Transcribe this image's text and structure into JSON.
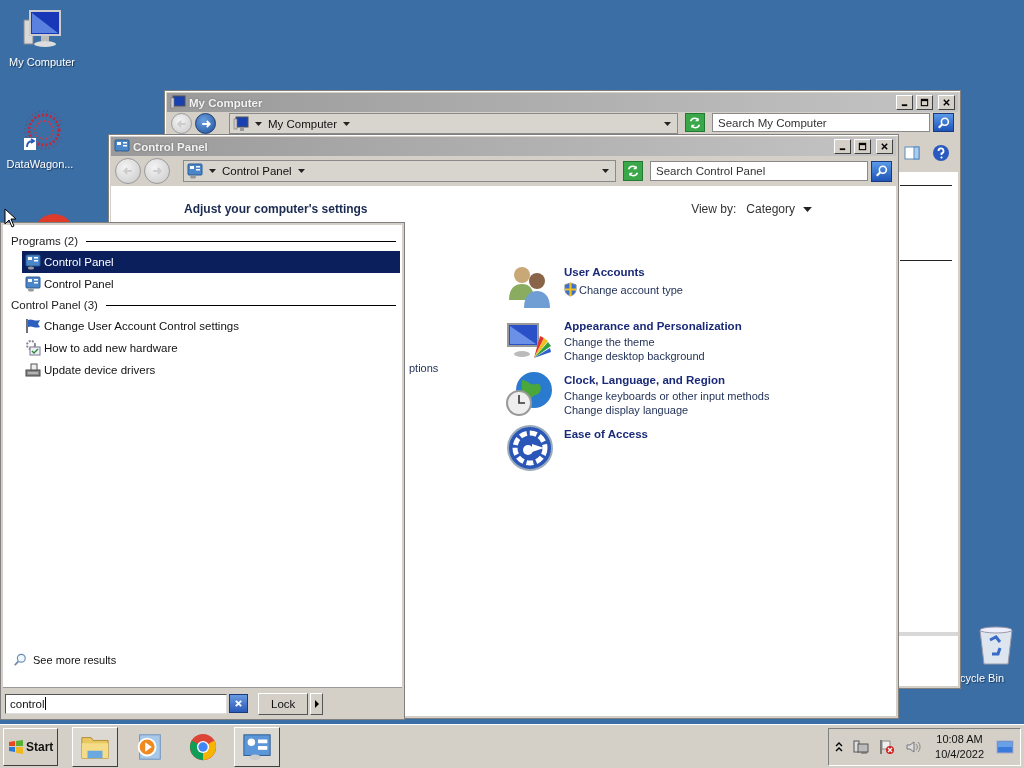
{
  "desktop_icons": [
    {
      "kind": "computer",
      "label": "My Computer"
    },
    {
      "kind": "datawagon",
      "label": "DataWagon..."
    },
    {
      "kind": "red-app"
    },
    {
      "kind": "recycle",
      "label": "cycle Bin"
    }
  ],
  "my_computer_window": {
    "title": "My Computer",
    "back_enabled": false,
    "forward_enabled": true,
    "address": "My Computer",
    "search_placeholder": "Search My Computer"
  },
  "control_panel_window": {
    "title": "Control Panel",
    "back_enabled": false,
    "forward_enabled": false,
    "address": "Control Panel",
    "search_placeholder": "Search Control Panel",
    "heading": "Adjust your computer's settings",
    "view_by_label": "View by:",
    "view_by_value": "Category",
    "left_fragment": "ptions",
    "categories": [
      {
        "kind": "users",
        "title": "User Accounts",
        "links": [
          {
            "text": "Change account type",
            "shield": true
          }
        ]
      },
      {
        "kind": "appearance",
        "title": "Appearance and Personalization",
        "links": [
          {
            "text": "Change the theme",
            "shield": false
          },
          {
            "text": "Change desktop background",
            "shield": false
          }
        ]
      },
      {
        "kind": "clock",
        "title": "Clock, Language, and Region",
        "links": [
          {
            "text": "Change keyboards or other input methods",
            "shield": false
          },
          {
            "text": "Change display language",
            "shield": false
          }
        ]
      },
      {
        "kind": "ease",
        "title": "Ease of Access"
      }
    ]
  },
  "start_menu": {
    "groups": [
      {
        "title": "Programs (2)",
        "items": [
          {
            "kind": "control-panel",
            "label": "Control Panel",
            "selected": true
          },
          {
            "kind": "control-panel",
            "label": "Control Panel",
            "selected": false
          }
        ]
      },
      {
        "title": "Control Panel (3)",
        "items": [
          {
            "kind": "flag",
            "label": "Change User Account Control settings",
            "selected": false
          },
          {
            "kind": "hardware",
            "label": "How to add new hardware",
            "selected": false
          },
          {
            "kind": "drivers",
            "label": "Update device drivers",
            "selected": false
          }
        ]
      }
    ],
    "see_more": "See more results",
    "search_value": "control",
    "lock_button": "Lock"
  },
  "taskbar": {
    "start_label": "Start",
    "pinned": [
      {
        "kind": "explorer",
        "running": true
      },
      {
        "kind": "media",
        "running": false
      },
      {
        "kind": "browser",
        "running": false
      },
      {
        "kind": "control-panel",
        "running": true
      }
    ],
    "time": "10:08 AM",
    "date": "10/4/2022"
  }
}
